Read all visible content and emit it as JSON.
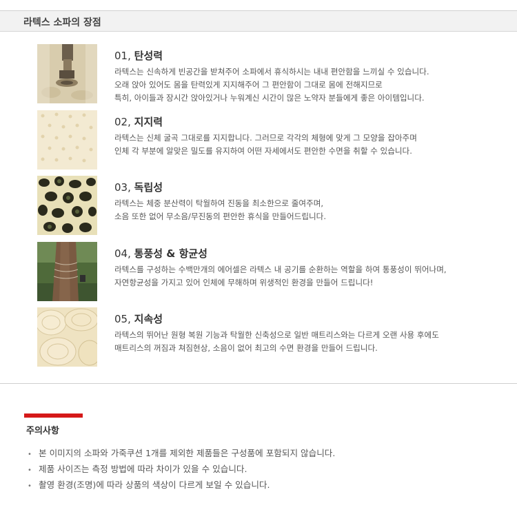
{
  "header": {
    "title": "라텍스 소파의 장점"
  },
  "features": [
    {
      "num": "01,",
      "name": "탄성력",
      "lines": [
        "라텍스는 신속하게 빈공간을 받쳐주어 소파에서 휴식하시는 내내 편안함을 느끼실 수 있습니다.",
        "오래 앉아 있어도 몸을 탄력있게 지지해주어 그 편안함이 그대로 몸에 전해지므로",
        "특히, 아이들과 장시간 앉아있거나 누워계신 시간이 많은 노약자 분들에게 좋은 아이템입니다."
      ]
    },
    {
      "num": "02,",
      "name": "지지력",
      "lines": [
        "라텍스는 신체 굴곡 그대로를 지지합니다. 그러므로 각각의 체형에 맞게 그 모양을 잡아주며",
        "인체 각 부분에 알맞은 밀도를 유지하여 어떤 자세에서도 편안한 수면을 취할 수 있습니다."
      ]
    },
    {
      "num": "03,",
      "name": "독립성",
      "lines": [
        "라텍스는 체중 분산력이 탁월하여 진동을 최소한으로 줄여주며,",
        "소음 또한 없어 무소음/무진동의 편안한 휴식을 만들어드립니다."
      ]
    },
    {
      "num": "04,",
      "name": "통풍성 & 항균성",
      "lines": [
        "라텍스를 구성하는 수백만개의 에어셀은 라텍스 내 공기를 순환하는 역할을 하여 통풍성이 뛰어나며,",
        "자연항균성을 가지고 있어 인체에 무해하며 위생적인 환경을 만들어 드립니다!"
      ]
    },
    {
      "num": "05,",
      "name": "지속성",
      "lines": [
        "라텍스의 뛰어난 원형 복원 기능과 탁월한 신축성으로 일반 매트리스와는 다르게 오랜 사용 후에도",
        "매트리스의 꺼짐과 쳐짐현상, 소음이 없어 최고의 수면 환경을 만들어 드립니다."
      ]
    }
  ],
  "notice": {
    "title": "주의사항",
    "items": [
      "본 이미지의 소파와 가죽쿠션 1개를 제외한 제품들은 구성품에 포함되지 않습니다.",
      "제품 사이즈는 측정 방법에 따라 차이가 있을 수 있습니다.",
      "촬영 환경(조명)에 따라 상품의 색상이 다르게 보일 수 있습니다."
    ]
  },
  "colors": {
    "accent": "#d51919",
    "header_bg": "#f2f2f2",
    "latex": "#f3ead2"
  }
}
